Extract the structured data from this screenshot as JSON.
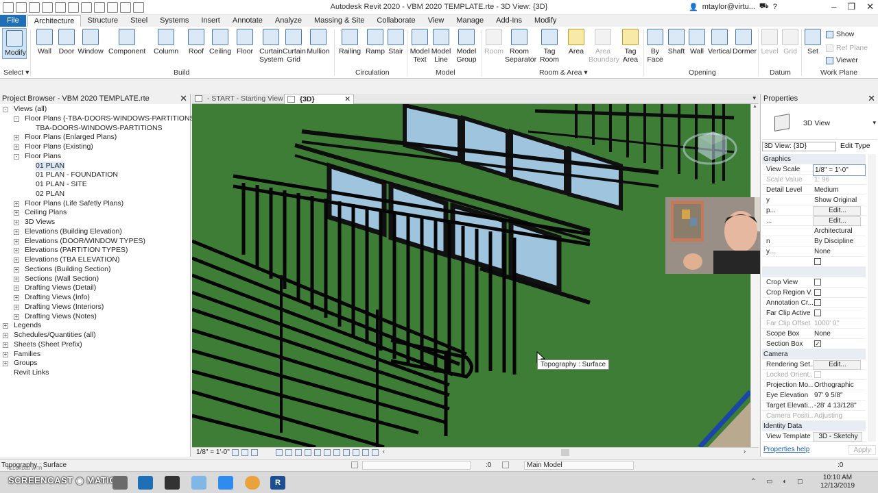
{
  "app": {
    "title": "Autodesk Revit 2020 - VBM 2020 TEMPLATE.rte - 3D View: {3D}",
    "user": "mtaylor@virtu..."
  },
  "ribbon_tabs": [
    "File",
    "Architecture",
    "Structure",
    "Steel",
    "Systems",
    "Insert",
    "Annotate",
    "Analyze",
    "Massing & Site",
    "Collaborate",
    "View",
    "Manage",
    "Add-Ins",
    "Modify"
  ],
  "ribbon": {
    "modify": "Modify",
    "select": "Select",
    "wall": "Wall",
    "door": "Door",
    "window": "Window",
    "component": "Component",
    "column": "Column",
    "roof": "Roof",
    "ceiling": "Ceiling",
    "floor": "Floor",
    "curtain_system": "Curtain\nSystem",
    "curtain_grid": "Curtain\nGrid",
    "mullion": "Mullion",
    "railing": "Railing",
    "ramp": "Ramp",
    "stair": "Stair",
    "model_text": "Model\nText",
    "model_line": "Model\nLine",
    "model_group": "Model\nGroup",
    "room": "Room",
    "room_separator": "Room\nSeparator",
    "tag_room": "Tag\nRoom",
    "area": "Area",
    "area_boundary": "Area\nBoundary",
    "tag_area": "Tag\nArea",
    "by_face": "By\nFace",
    "shaft": "Shaft",
    "wall_opening": "Wall",
    "vertical": "Vertical",
    "dormer": "Dormer",
    "level": "Level",
    "grid": "Grid",
    "set": "Set",
    "show": "Show",
    "ref_plane": "Ref  Plane",
    "viewer": "Viewer",
    "panels": {
      "build": "Build",
      "circulation": "Circulation",
      "model": "Model",
      "room_area": "Room & Area",
      "opening": "Opening",
      "datum": "Datum",
      "work_plane": "Work Plane"
    }
  },
  "project_browser": {
    "title": "Project Browser - VBM 2020 TEMPLATE.rte",
    "items": [
      "Views (all)",
      "Floor Plans (-TBA-DOORS-WINDOWS-PARTITIONS)",
      "TBA-DOORS-WINDOWS-PARTITIONS",
      "Floor Plans (Enlarged Plans)",
      "Floor Plans (Existing)",
      "Floor Plans",
      "01 PLAN",
      "01 PLAN - FOUNDATION",
      "01 PLAN - SITE",
      "02 PLAN",
      "Floor Plans (Life Safetly Plans)",
      "Ceiling Plans",
      "3D Views",
      "Elevations (Building Elevation)",
      "Elevations (DOOR/WINDOW TYPES)",
      "Elevations (PARTITION TYPES)",
      "Elevations (TBA ELEVATION)",
      "Sections (Building Section)",
      "Sections (Wall Section)",
      "Drafting Views (Detail)",
      "Drafting Views (Info)",
      "Drafting Views (Interiors)",
      "Drafting Views (Notes)",
      "Legends",
      "Schedules/Quantities (all)",
      "Sheets (Sheet Prefix)",
      "Families",
      "Groups",
      "Revit Links"
    ]
  },
  "view_tabs": {
    "start": "- START - Starting View",
    "three_d": "{3D}"
  },
  "view_control": {
    "scale": "1/8\" = 1'-0\""
  },
  "tooltip": "Topography : Surface",
  "properties": {
    "title": "Properties",
    "type_name": "3D View",
    "selector": "3D View: {3D}",
    "edit_type": "Edit Type",
    "groups": {
      "graphics": "Graphics",
      "camera": "Camera",
      "identity": "Identity Data"
    },
    "rows": {
      "view_scale": {
        "name": "View Scale",
        "value": "1/8\" = 1'-0\""
      },
      "scale_value": {
        "name": "Scale Value",
        "value": "1:  96"
      },
      "detail_level": {
        "name": "Detail Level",
        "value": "Medium"
      },
      "r_show_original": {
        "name": "y",
        "value": "Show Original"
      },
      "r_edit1": {
        "name": "p...",
        "value": "Edit..."
      },
      "r_edit2": {
        "name": "...",
        "value": "Edit..."
      },
      "r_architectural": {
        "value": "Architectural"
      },
      "r_by_discipline": {
        "name": "n",
        "value": "By Discipline"
      },
      "r_none": {
        "name": "y...",
        "value": "None"
      },
      "crop_view": {
        "name": "Crop View"
      },
      "crop_region": {
        "name": "Crop Region V..."
      },
      "annotation_crop": {
        "name": "Annotation Cr..."
      },
      "far_clip_active": {
        "name": "Far Clip Active"
      },
      "far_clip_offset": {
        "name": "Far Clip Offset",
        "value": "1000'  0\""
      },
      "scope_box": {
        "name": "Scope Box",
        "value": "None"
      },
      "section_box": {
        "name": "Section Box"
      },
      "rendering": {
        "name": "Rendering Set...",
        "value": "Edit..."
      },
      "locked_orient": {
        "name": "Locked Orient..."
      },
      "projection": {
        "name": "Projection Mo...",
        "value": "Orthographic"
      },
      "eye_elev": {
        "name": "Eye Elevation",
        "value": "97'  9 5/8\""
      },
      "target_elev": {
        "name": "Target Elevati...",
        "value": "-28'  4 13/128\""
      },
      "camera_pos": {
        "name": "Camera Positi...",
        "value": "Adjusting"
      },
      "view_template": {
        "name": "View Template",
        "value": "3D - Sketchy"
      }
    },
    "help": "Properties help",
    "apply": "Apply"
  },
  "status": {
    "text": "Topography : Surface",
    "watermark": "RECORDED WITH",
    "zero": ":0",
    "model": "Main Model",
    "filter": ":0"
  },
  "taskbar": {
    "logo": "SCREENCAST ◉ MATIC",
    "time": "10:10 AM",
    "date": "12/13/2019"
  },
  "colors": {
    "accent": "#1e6fb8",
    "grass": "#3d7d36",
    "glass": "#9fc4dd"
  }
}
